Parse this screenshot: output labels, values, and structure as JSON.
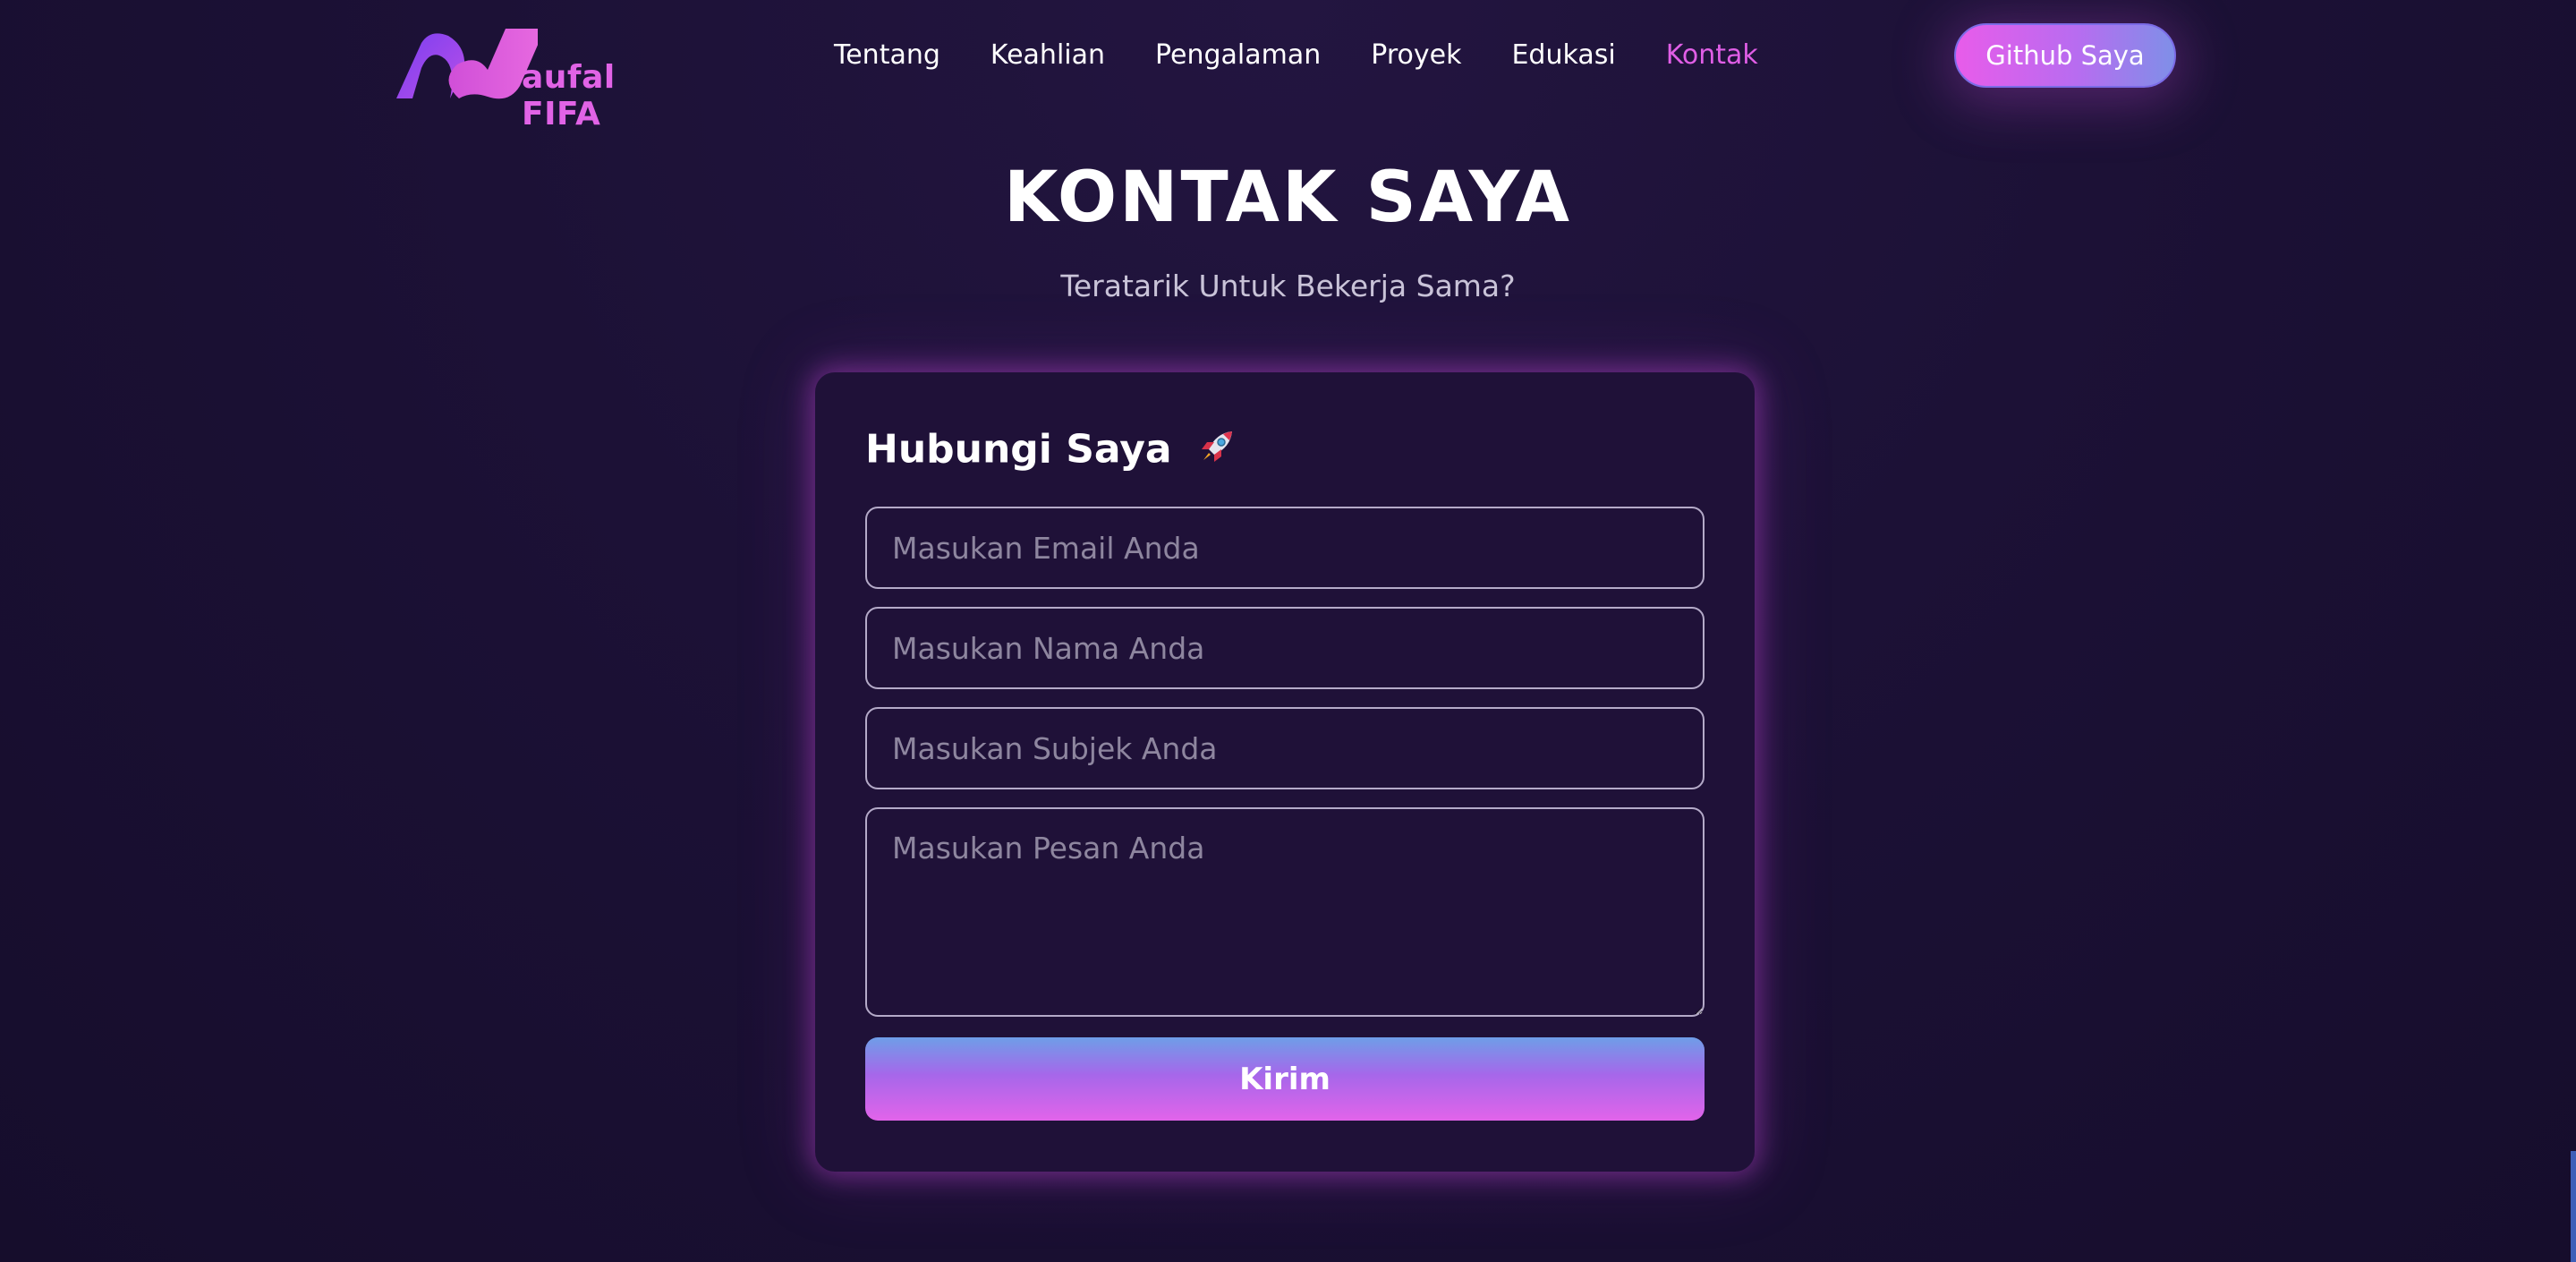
{
  "brand": {
    "logo_text": "aufal FIFA"
  },
  "nav": {
    "items": [
      {
        "label": "Tentang"
      },
      {
        "label": "Keahlian"
      },
      {
        "label": "Pengalaman"
      },
      {
        "label": "Proyek"
      },
      {
        "label": "Edukasi"
      },
      {
        "label": "Kontak",
        "active": true
      }
    ],
    "github_label": "Github Saya"
  },
  "hero": {
    "title": "KONTAK SAYA",
    "subtitle": "Teratarik Untuk Bekerja Sama?"
  },
  "form": {
    "title": "Hubungi Saya",
    "title_icon": "rocket-icon",
    "email_placeholder": "Masukan Email Anda",
    "name_placeholder": "Masukan Nama Anda",
    "subject_placeholder": "Masukan Subjek Anda",
    "message_placeholder": "Masukan Pesan Anda",
    "submit_label": "Kirim"
  },
  "colors": {
    "background": "#1c1136",
    "card": "#1f1138",
    "accent_pink": "#e05ee6",
    "accent_purple": "#a667ea",
    "accent_blue": "#6e9ee8"
  }
}
